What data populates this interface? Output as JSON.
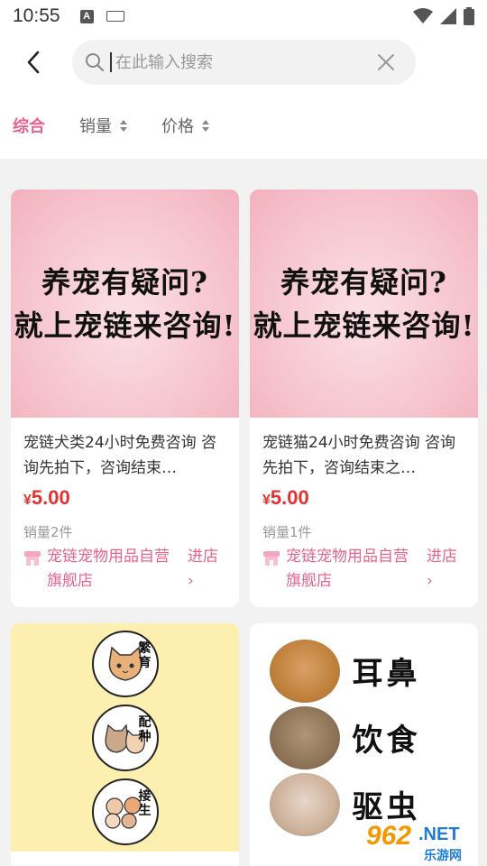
{
  "status_bar": {
    "time": "10:55",
    "a_badge": "A"
  },
  "search": {
    "placeholder": "在此输入搜索",
    "back_icon": "chevron-left-icon",
    "search_icon": "search-icon",
    "clear_icon": "close-icon"
  },
  "filters": {
    "items": [
      {
        "label": "综合",
        "active": true
      },
      {
        "label": "销量",
        "sortable": true
      },
      {
        "label": "价格",
        "sortable": true
      }
    ],
    "active_color": "#e8648c"
  },
  "products": [
    {
      "image_lines": [
        "养宠有疑问?",
        "就上宠链来咨询!"
      ],
      "title": "宠链犬类24小时免费咨询 咨询先拍下，咨询结束…",
      "currency": "¥",
      "price": "5.00",
      "sold": "销量2件",
      "store": "宠链宠物用品自营旗舰店",
      "enter": "进店",
      "enter_arrow": "›"
    },
    {
      "image_lines": [
        "养宠有疑问?",
        "就上宠链来咨询!"
      ],
      "title": "宠链猫24小时免费咨询 咨询先拍下，咨询结束之…",
      "currency": "¥",
      "price": "5.00",
      "sold": "销量1件",
      "store": "宠链宠物用品自营旗舰店",
      "enter": "进店",
      "enter_arrow": "›"
    },
    {
      "image_tags": [
        "繁育",
        "配种",
        "接生"
      ]
    },
    {
      "image_words": [
        "耳鼻",
        "饮食",
        "驱虫"
      ]
    }
  ],
  "watermark": {
    "num": "962",
    "net": ".NET",
    "sub": "乐游网"
  },
  "colors": {
    "accent": "#e8648c",
    "price": "#e0322e"
  }
}
